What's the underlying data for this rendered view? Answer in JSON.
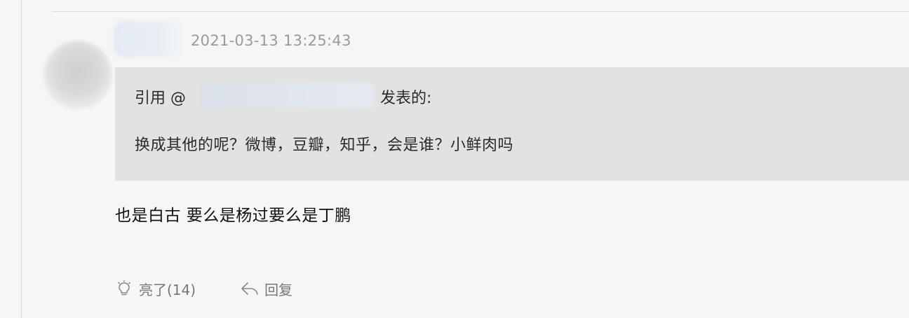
{
  "post": {
    "timestamp": "2021-03-13 13:25:43",
    "quote": {
      "prefix": "引用 @",
      "suffix": "发表的:",
      "text": "换成其他的呢？微博，豆瓣，知乎，会是谁？小鲜肉吗"
    },
    "content": "也是白古 要么是杨过要么是丁鹏",
    "actions": {
      "like_label": "亮了(14)",
      "reply_label": "回复"
    }
  },
  "icons": {
    "like": "lightbulb-icon",
    "reply": "reply-arrow-icon"
  },
  "colors": {
    "background": "#f6f6f6",
    "quote_background": "#e2e2e2",
    "timestamp": "#9a9a9a",
    "action_text": "#777777"
  }
}
